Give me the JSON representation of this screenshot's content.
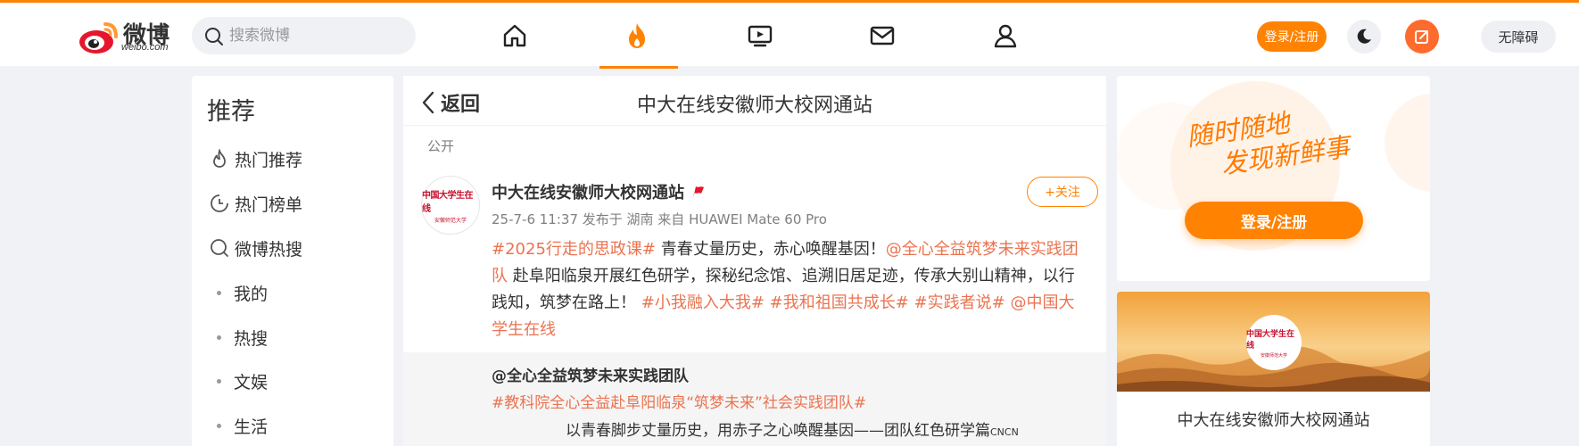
{
  "header": {
    "logo_text": "微博",
    "logo_sub": "weibo.com",
    "search_placeholder": "搜索微博",
    "nav": [
      "home-icon",
      "hot-icon",
      "video-icon",
      "mail-icon",
      "profile-icon"
    ],
    "login_label": "登录/注册",
    "accessibility_label": "无障碍",
    "accent": "#ff8200"
  },
  "sidebar": {
    "title": "推荐",
    "items": [
      {
        "label": "热门推荐",
        "icon": "fire-outline-icon"
      },
      {
        "label": "热门榜单",
        "icon": "clock-chart-icon"
      },
      {
        "label": "微博热搜",
        "icon": "search-circle-icon"
      },
      {
        "label": "我的",
        "icon": "dot"
      },
      {
        "label": "热搜",
        "icon": "dot"
      },
      {
        "label": "文娱",
        "icon": "dot"
      },
      {
        "label": "生活",
        "icon": "dot"
      }
    ]
  },
  "main": {
    "back_label": "返回",
    "page_title": "中大在线安徽师大校网通站",
    "visibility": "公开",
    "post": {
      "author": "中大在线安徽师大校网通站",
      "meta": "25-7-6 11:37 发布于 湖南 来自 HUAWEI Mate 60 Pro",
      "follow_label": "+关注",
      "avatar_line1": "中国大学生在线",
      "avatar_line2": "安徽师范大学",
      "text": {
        "tag1": "#2025行走的思政课#",
        "t1": " 青春丈量历史，赤心唤醒基因！",
        "mention1": "@全心全益筑梦未来实践团队",
        "t2": " 赴阜阳临泉开展红色研学，探秘纪念馆、追溯旧居足迹，传承大别山精神，以行践知，筑梦在路上！",
        "tag2": "#小我融入大我#",
        "tag3": "#我和祖国共成长#",
        "tag4": "#实践者说#",
        "mention2": "@中国大学生在线"
      }
    },
    "quote": {
      "author": "@全心全益筑梦未来实践团队",
      "tag": "#教科院全心全益赴阜阳临泉“筑梦未来”社会实践团队#",
      "line": "以青春脚步丈量历史，用赤子之心唤醒基因——团队红色研学篇",
      "line_suffix": "CNCN"
    }
  },
  "right": {
    "slogan_line1": "随时随地",
    "slogan_line2": "发现新鲜事",
    "register_label": "登录/注册",
    "banner_logo_line1": "中国大学生在线",
    "banner_logo_line2": "安徽师范大学",
    "account_title": "中大在线安徽师大校网通站"
  }
}
